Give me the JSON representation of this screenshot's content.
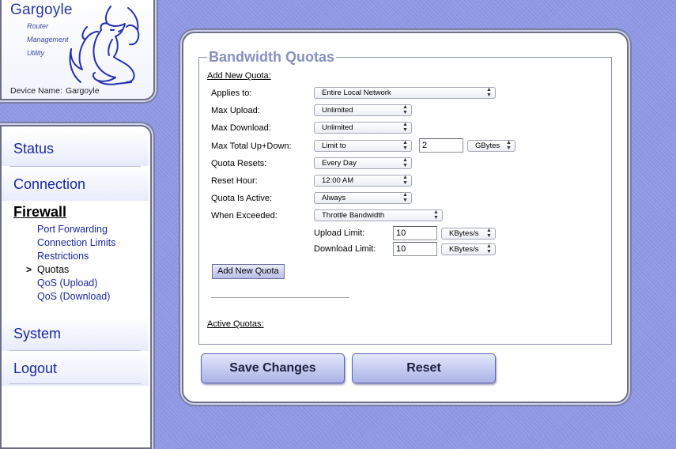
{
  "logo": {
    "brand": "Gargoyle",
    "tagline": [
      "Router",
      "Management",
      "Utility"
    ],
    "device_label": "Device Name:",
    "device_name": "Gargoyle"
  },
  "nav": {
    "items": [
      {
        "label": "Status"
      },
      {
        "label": "Connection"
      },
      {
        "label": "Firewall"
      },
      {
        "label": "System"
      },
      {
        "label": "Logout"
      }
    ],
    "firewall_sub": [
      {
        "label": "Port Forwarding"
      },
      {
        "label": "Connection Limits"
      },
      {
        "label": "Restrictions"
      },
      {
        "label": "Quotas"
      },
      {
        "label": "QoS (Upload)"
      },
      {
        "label": "QoS (Download)"
      }
    ],
    "active_marker": ">"
  },
  "form": {
    "title": "Bandwidth Quotas",
    "add_section": "Add New Quota:",
    "fields": {
      "applies_to": {
        "label": "Applies to:",
        "value": "Entire Local Network"
      },
      "max_upload": {
        "label": "Max Upload:",
        "value": "Unlimited"
      },
      "max_download": {
        "label": "Max Download:",
        "value": "Unlimited"
      },
      "max_total": {
        "label": "Max Total Up+Down:",
        "value": "Limit to",
        "amount": "2",
        "unit": "GBytes"
      },
      "quota_resets": {
        "label": "Quota Resets:",
        "value": "Every Day"
      },
      "reset_hour": {
        "label": "Reset Hour:",
        "value": "12:00 AM"
      },
      "quota_active": {
        "label": "Quota Is Active:",
        "value": "Always"
      },
      "when_exceeded": {
        "label": "When Exceeded:",
        "value": "Throttle Bandwidth"
      },
      "upload_limit": {
        "label": "Upload Limit:",
        "value": "10",
        "unit": "KBytes/s"
      },
      "download_limit": {
        "label": "Download Limit:",
        "value": "10",
        "unit": "KBytes/s"
      }
    },
    "add_button": "Add New Quota",
    "active_section": "Active Quotas:"
  },
  "actions": {
    "save": "Save Changes",
    "reset": "Reset"
  }
}
